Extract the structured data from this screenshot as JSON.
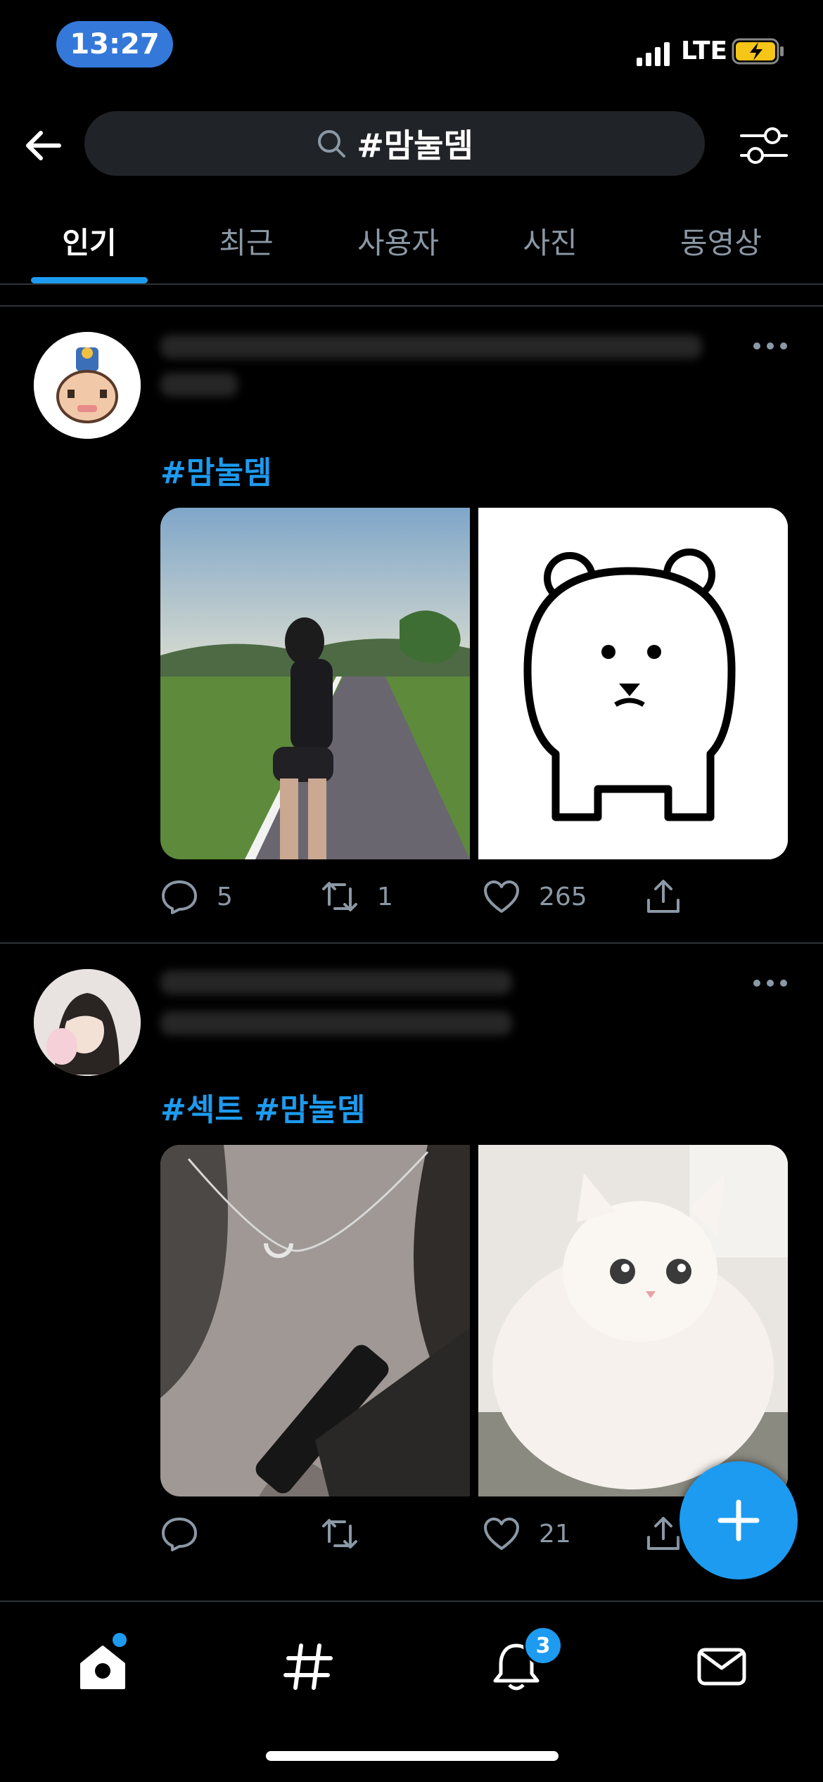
{
  "status_bar": {
    "time": "13:27",
    "network": "LTE"
  },
  "search": {
    "query": "#맘눌뎀"
  },
  "tabs": [
    {
      "label": "인기",
      "active": true
    },
    {
      "label": "최근",
      "active": false
    },
    {
      "label": "사용자",
      "active": false
    },
    {
      "label": "사진",
      "active": false
    },
    {
      "label": "동영상",
      "active": false
    }
  ],
  "posts": [
    {
      "hashtags": "#맘눌뎀",
      "images": [
        "photo-person-on-road",
        "drawing-white-bear"
      ],
      "replies": "5",
      "retweets": "1",
      "likes": "265"
    },
    {
      "hashtags": "#섹트 #맘눌뎀",
      "images": [
        "photo-necklace",
        "photo-white-kitten"
      ],
      "replies": "",
      "retweets": "",
      "likes": "21"
    }
  ],
  "bottom_nav": {
    "items": [
      "home-icon",
      "hashtag-icon",
      "notifications-icon",
      "messages-icon"
    ],
    "notifications_badge": "3"
  },
  "colors": {
    "accent": "#1d9bf0",
    "background": "#000000",
    "muted": "#8b98a5"
  }
}
